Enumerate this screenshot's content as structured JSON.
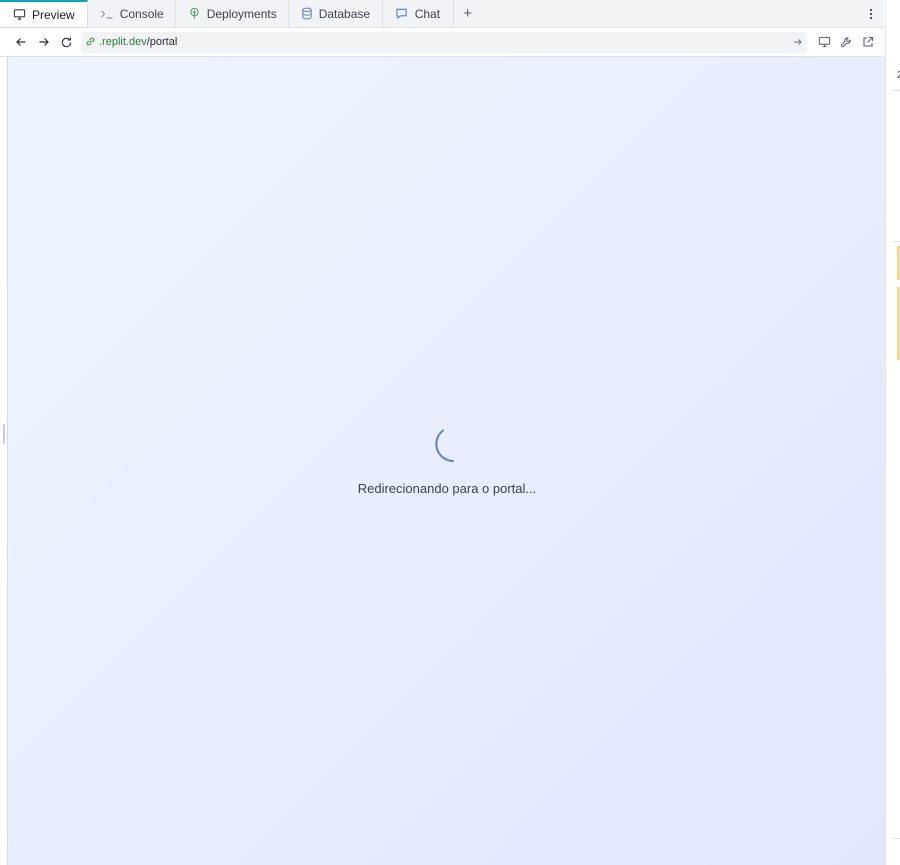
{
  "tabs": [
    {
      "label": "Preview",
      "icon": "monitor-icon",
      "active": true
    },
    {
      "label": "Console",
      "icon": "terminal-icon",
      "active": false
    },
    {
      "label": "Deployments",
      "icon": "deployments-icon",
      "active": false
    },
    {
      "label": "Database",
      "icon": "database-icon",
      "active": false
    },
    {
      "label": "Chat",
      "icon": "chat-icon",
      "active": false
    }
  ],
  "tab_add_label": "+",
  "url": {
    "domain": ".replit.dev",
    "path": "/portal"
  },
  "preview": {
    "loading_text": "Redirecionando para o portal..."
  },
  "colors": {
    "active_tab_accent": "#0aa8b9",
    "url_domain": "#2a7d3a",
    "spinner": "#5b7fd6",
    "background_start": "#eef4ff",
    "background_end": "#e1e7fd"
  }
}
